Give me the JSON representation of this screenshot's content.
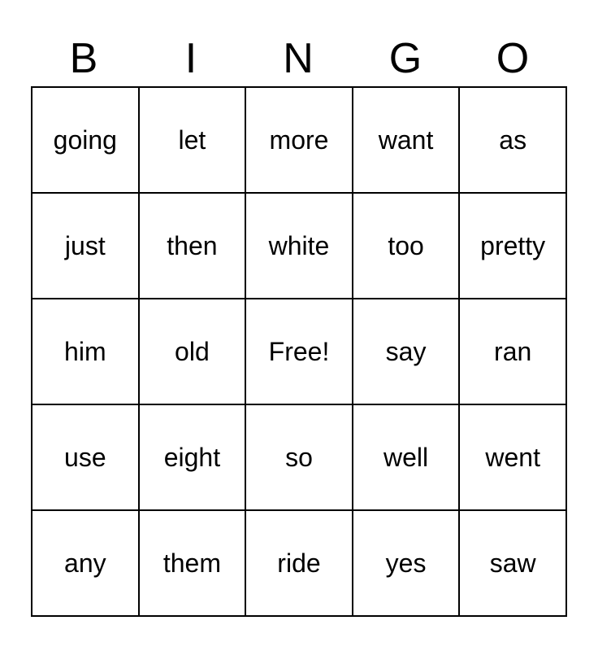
{
  "header": {
    "letters": [
      "B",
      "I",
      "N",
      "G",
      "O"
    ]
  },
  "grid": {
    "rows": [
      [
        "going",
        "let",
        "more",
        "want",
        "as"
      ],
      [
        "just",
        "then",
        "white",
        "too",
        "pretty"
      ],
      [
        "him",
        "old",
        "Free!",
        "say",
        "ran"
      ],
      [
        "use",
        "eight",
        "so",
        "well",
        "went"
      ],
      [
        "any",
        "them",
        "ride",
        "yes",
        "saw"
      ]
    ]
  }
}
